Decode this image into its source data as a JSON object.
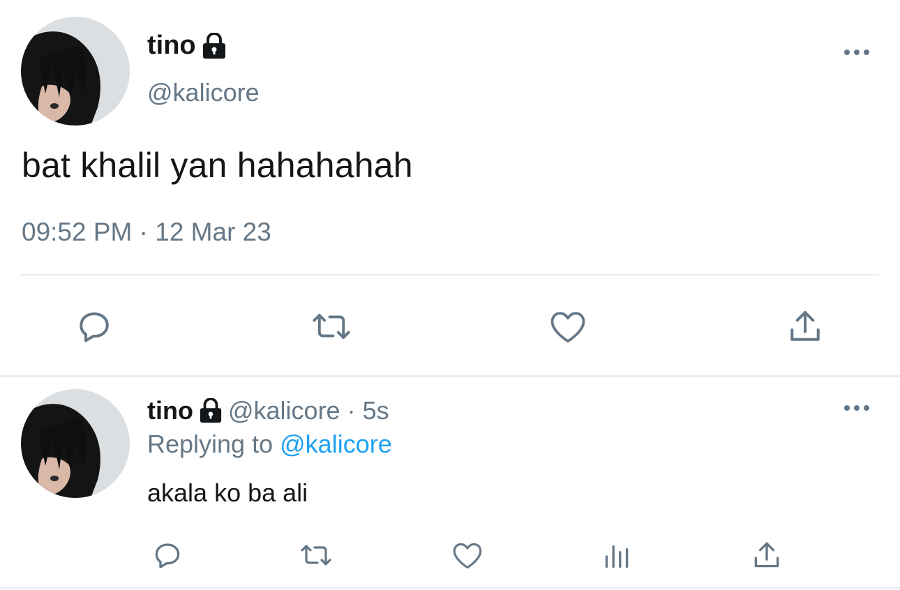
{
  "main_tweet": {
    "name": "tino",
    "handle": "@kalicore",
    "text": "bat khalil yan hahahahah",
    "timestamp": "09:52 PM · 12 Mar 23",
    "icons": [
      "lock-icon",
      "more-icon",
      "reply-icon",
      "retweet-icon",
      "like-icon",
      "share-icon"
    ]
  },
  "reply_tweet": {
    "name": "tino",
    "handle_time": "@kalicore · 5s",
    "replying_prefix": "Replying to",
    "replying_handle": "@kalicore",
    "text": "akala ko ba ali",
    "icons": [
      "lock-icon",
      "more-icon",
      "reply-icon",
      "retweet-icon",
      "like-icon",
      "analytics-icon",
      "share-icon"
    ]
  },
  "colors": {
    "text": "#14171a",
    "secondary": "#657786",
    "link": "#1da1f2",
    "divider": "#e6ecf0"
  }
}
